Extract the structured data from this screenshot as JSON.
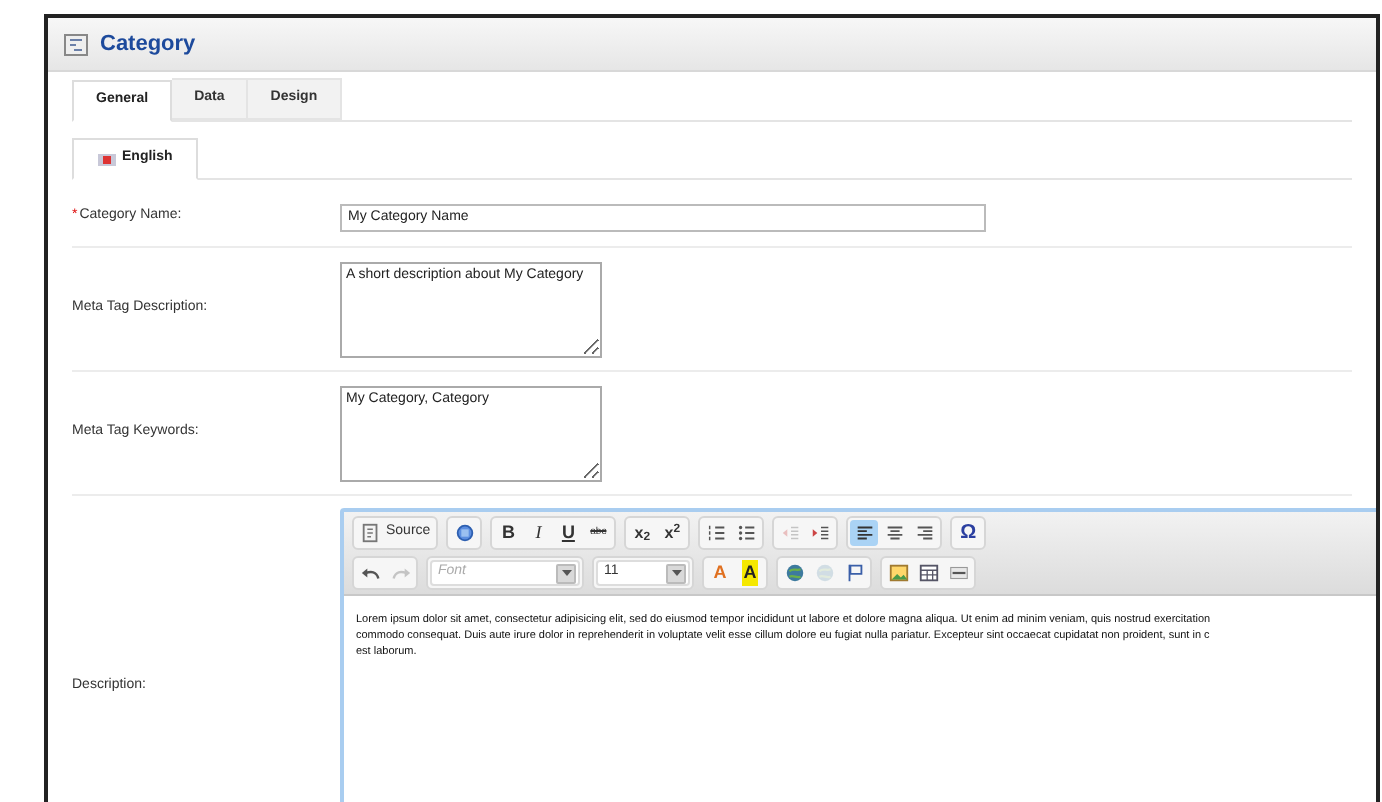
{
  "window": {
    "title": "Category"
  },
  "tabs": [
    {
      "label": "General",
      "selected": true
    },
    {
      "label": "Data",
      "selected": false
    },
    {
      "label": "Design",
      "selected": false
    }
  ],
  "language_tabs": [
    {
      "label": "English",
      "selected": true
    }
  ],
  "fields": [
    {
      "kind": "input",
      "required_mark": "*",
      "label": "Category Name:",
      "value": "My Category Name"
    },
    {
      "kind": "textarea",
      "label": "Meta Tag Description:",
      "value": "A short description about My Category"
    },
    {
      "kind": "textarea",
      "label": "Meta Tag Keywords:",
      "value": "My Category, Category"
    },
    {
      "kind": "editor",
      "label": "Description:",
      "lines": [
        "Lorem ipsum dolor sit amet, consectetur adipisicing elit, sed do eiusmod tempor incididunt ut labore et dolore magna aliqua. Ut enim ad minim veniam, quis nostrud exercitation",
        "commodo consequat. Duis aute irure dolor in reprehenderit in voluptate velit esse cillum dolore eu fugiat nulla pariatur. Excepteur sint occaecat cupidatat non proident, sunt in c",
        "est laborum."
      ]
    }
  ],
  "toolbar": [
    [
      [
        {
          "kind": "source",
          "label": "Source",
          "disabled": false
        }
      ],
      [
        {
          "kind": "template",
          "disabled": false
        }
      ],
      [
        {
          "kind": "bold",
          "label": "B",
          "disabled": false
        },
        {
          "kind": "italic",
          "label": "I",
          "disabled": false
        },
        {
          "kind": "underline",
          "label": "U",
          "disabled": false
        },
        {
          "kind": "strike",
          "label": "abc",
          "disabled": false
        }
      ],
      [
        {
          "kind": "subscript",
          "label": "x$_{2}$",
          "disabled": false
        },
        {
          "kind": "superscript",
          "label": "x$^{2}$",
          "disabled": false
        }
      ],
      [
        {
          "kind": "numbered",
          "disabled": false
        },
        {
          "kind": "bulleted",
          "disabled": false
        }
      ],
      [
        {
          "kind": "outdent",
          "disabled": true
        },
        {
          "kind": "indent",
          "disabled": false
        }
      ],
      [
        {
          "kind": "left",
          "selected": true,
          "disabled": false
        },
        {
          "kind": "center",
          "selected": false,
          "disabled": false
        },
        {
          "kind": "right",
          "selected": false,
          "disabled": false
        }
      ],
      [
        {
          "kind": "symbol",
          "label": "Ω",
          "disabled": false
        }
      ]
    ],
    [
      [
        {
          "kind": "undo",
          "disabled": false
        },
        {
          "kind": "redo",
          "disabled": true
        }
      ],
      [
        {
          "kind": "combo",
          "placeholder": "Font",
          "disabled": false
        }
      ],
      [
        {
          "kind": "combo",
          "value": "11",
          "disabled": false
        }
      ],
      [
        {
          "kind": "textcolor",
          "label": "A",
          "disabled": false
        },
        {
          "kind": "bgcolor",
          "label": "A",
          "disabled": false
        }
      ],
      [
        {
          "kind": "link",
          "disabled": false
        },
        {
          "kind": "unlink",
          "disabled": true
        },
        {
          "kind": "anchor",
          "disabled": false
        }
      ],
      [
        {
          "kind": "image",
          "disabled": false
        },
        {
          "kind": "table",
          "disabled": false
        },
        {
          "kind": "rule",
          "disabled": false
        }
      ]
    ]
  ]
}
